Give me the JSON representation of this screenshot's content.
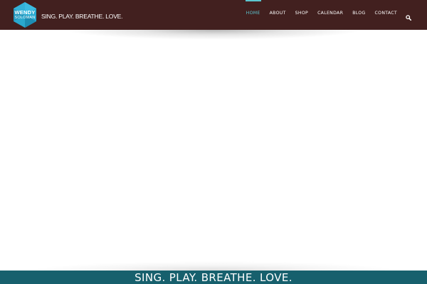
{
  "brand": {
    "first_name": "WENDY",
    "last_name": "SOLOMAN",
    "tagline": "SING. PLAY. BREATHE. LOVE.",
    "colors": {
      "header_bg": "#42201f",
      "logo_hex": "#2aa9cf",
      "nav_active": "#5cc6d0",
      "footer_bg": "#17606d"
    }
  },
  "nav": {
    "items": [
      {
        "label": "HOME",
        "active": true
      },
      {
        "label": "ABOUT",
        "active": false
      },
      {
        "label": "SHOP",
        "active": false
      },
      {
        "label": "CALENDAR",
        "active": false
      },
      {
        "label": "BLOG",
        "active": false
      },
      {
        "label": "CONTACT",
        "active": false
      }
    ],
    "search_icon": "search-icon"
  },
  "footer": {
    "text": "SING. PLAY. BREATHE. LOVE."
  }
}
